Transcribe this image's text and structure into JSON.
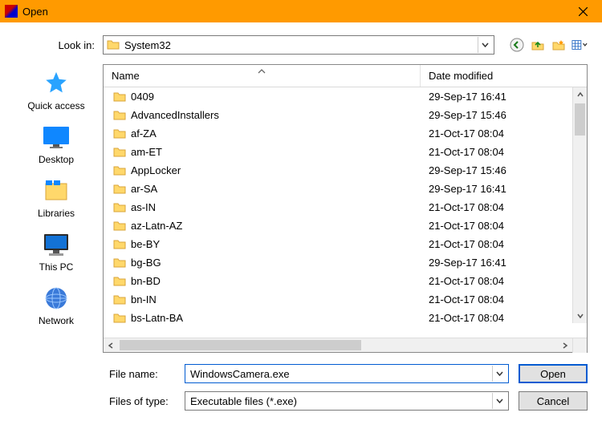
{
  "title": "Open",
  "lookIn": {
    "label": "Look in:",
    "value": "System32"
  },
  "toolbar": {
    "back": "back-icon",
    "up": "up-one-level-icon",
    "newFolder": "new-folder-icon",
    "viewMenu": "view-menu-icon"
  },
  "places": [
    {
      "key": "quick-access",
      "label": "Quick access"
    },
    {
      "key": "desktop",
      "label": "Desktop"
    },
    {
      "key": "libraries",
      "label": "Libraries"
    },
    {
      "key": "this-pc",
      "label": "This PC"
    },
    {
      "key": "network",
      "label": "Network"
    }
  ],
  "columns": {
    "name": "Name",
    "date": "Date modified"
  },
  "rows": [
    {
      "name": "0409",
      "date": "29-Sep-17 16:41"
    },
    {
      "name": "AdvancedInstallers",
      "date": "29-Sep-17 15:46"
    },
    {
      "name": "af-ZA",
      "date": "21-Oct-17 08:04"
    },
    {
      "name": "am-ET",
      "date": "21-Oct-17 08:04"
    },
    {
      "name": "AppLocker",
      "date": "29-Sep-17 15:46"
    },
    {
      "name": "ar-SA",
      "date": "29-Sep-17 16:41"
    },
    {
      "name": "as-IN",
      "date": "21-Oct-17 08:04"
    },
    {
      "name": "az-Latn-AZ",
      "date": "21-Oct-17 08:04"
    },
    {
      "name": "be-BY",
      "date": "21-Oct-17 08:04"
    },
    {
      "name": "bg-BG",
      "date": "29-Sep-17 16:41"
    },
    {
      "name": "bn-BD",
      "date": "21-Oct-17 08:04"
    },
    {
      "name": "bn-IN",
      "date": "21-Oct-17 08:04"
    },
    {
      "name": "bs-Latn-BA",
      "date": "21-Oct-17 08:04"
    }
  ],
  "fileName": {
    "label": "File name:",
    "value": "WindowsCamera.exe"
  },
  "filesOfType": {
    "label": "Files of type:",
    "value": "Executable files (*.exe)"
  },
  "buttons": {
    "open": "Open",
    "cancel": "Cancel"
  }
}
